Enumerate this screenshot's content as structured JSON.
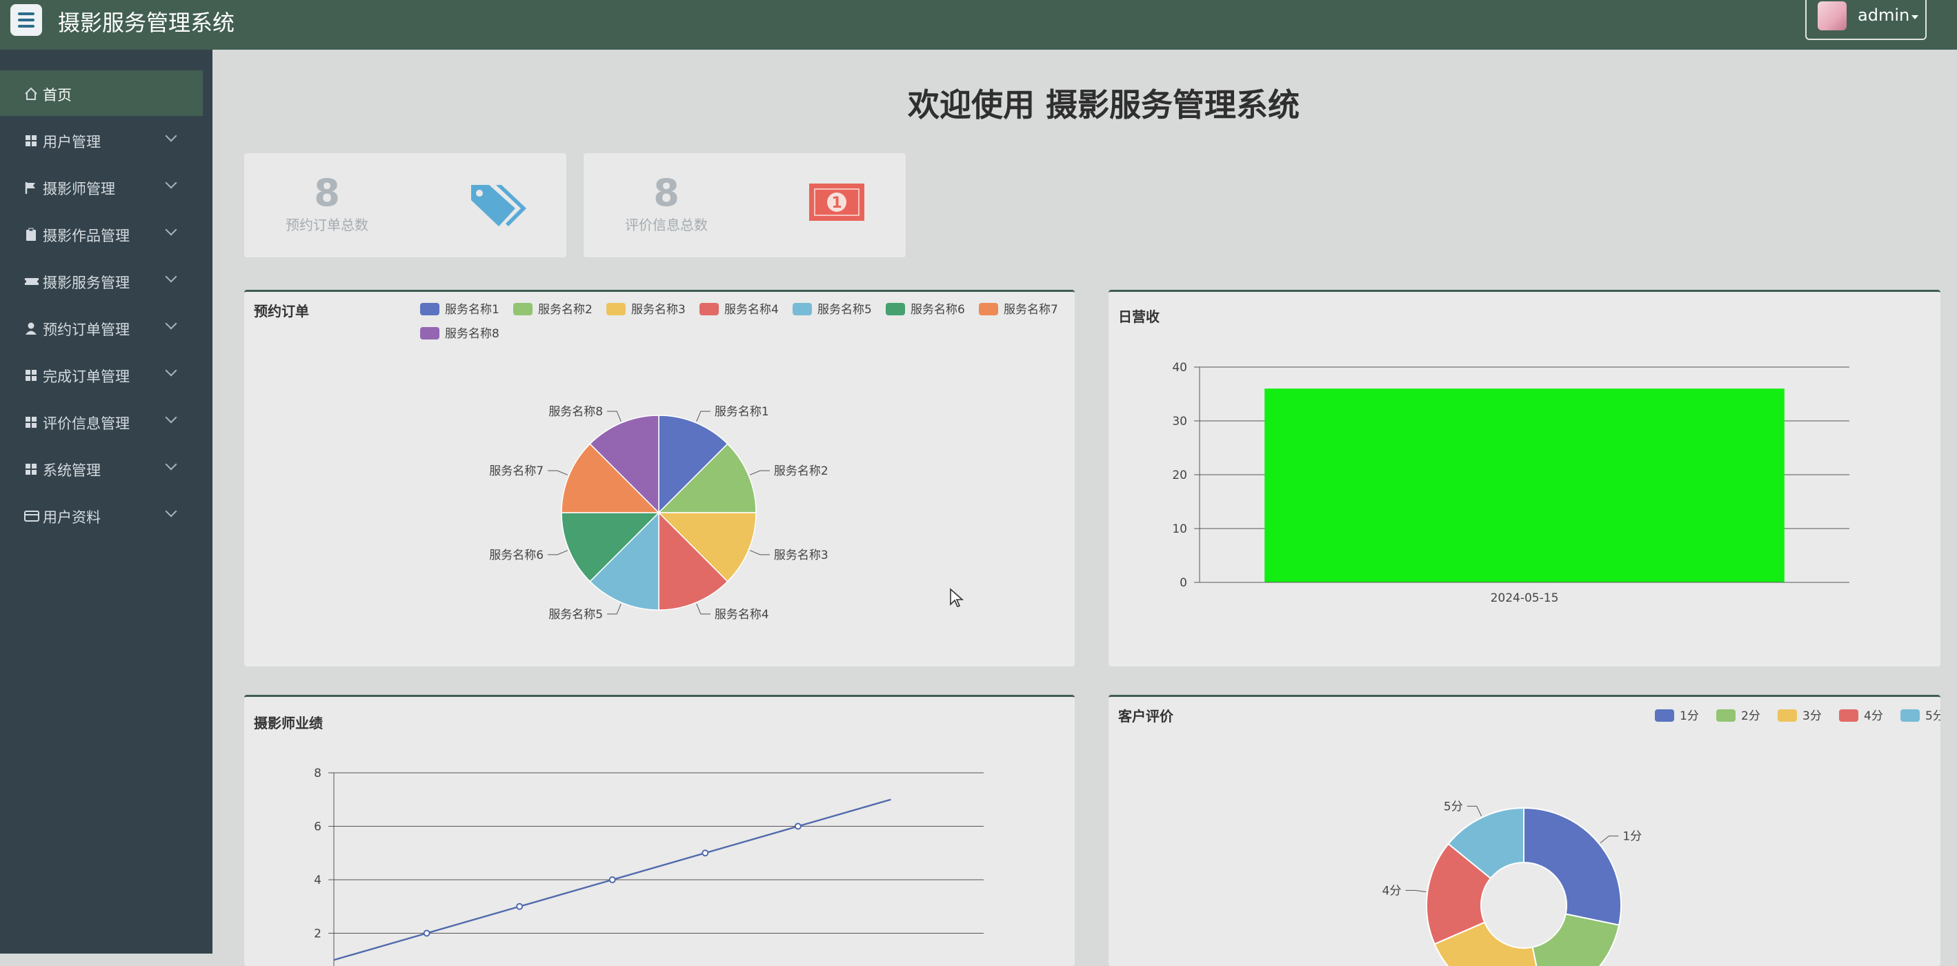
{
  "header": {
    "title": "摄影服务管理系统",
    "user": "admin"
  },
  "sidebar": {
    "items": [
      {
        "label": "首页",
        "icon": "home-icon",
        "active": true
      },
      {
        "label": "用户管理",
        "icon": "grid-icon"
      },
      {
        "label": "摄影师管理",
        "icon": "flag-icon"
      },
      {
        "label": "摄影作品管理",
        "icon": "clipboard-icon"
      },
      {
        "label": "摄影服务管理",
        "icon": "ticket-icon"
      },
      {
        "label": "预约订单管理",
        "icon": "user-icon"
      },
      {
        "label": "完成订单管理",
        "icon": "grid-icon"
      },
      {
        "label": "评价信息管理",
        "icon": "grid-icon"
      },
      {
        "label": "系统管理",
        "icon": "grid-icon"
      },
      {
        "label": "用户资料",
        "icon": "card-icon"
      }
    ]
  },
  "main": {
    "welcome": "欢迎使用 摄影服务管理系统"
  },
  "stats": [
    {
      "value": "8",
      "label": "预约订单总数",
      "icon": "tags-icon",
      "color": "#5aaad6"
    },
    {
      "value": "8",
      "label": "评价信息总数",
      "icon": "money-icon",
      "color": "#e8645a"
    }
  ],
  "panels": {
    "orders": "预约订单",
    "revenue": "日营收",
    "performance": "摄影师业绩",
    "reviews": "客户评价"
  },
  "chart_data": [
    {
      "type": "pie",
      "title": "预约订单",
      "categories": [
        "服务名称1",
        "服务名称2",
        "服务名称3",
        "服务名称4",
        "服务名称5",
        "服务名称6",
        "服务名称7",
        "服务名称8"
      ],
      "values": [
        1,
        1,
        1,
        1,
        1,
        1,
        1,
        1
      ],
      "colors": [
        "#5b73c0",
        "#92c472",
        "#efc35c",
        "#e16a67",
        "#78bbd6",
        "#46a070",
        "#ee8a55",
        "#9466b2"
      ],
      "legend": "top"
    },
    {
      "type": "bar",
      "title": "日营收",
      "categories": [
        "2024-05-15"
      ],
      "values": [
        36
      ],
      "ylim": [
        0,
        40
      ],
      "yticks": [
        0,
        10,
        20,
        30,
        40
      ],
      "color": "#12ee12",
      "grid": true
    },
    {
      "type": "line",
      "title": "摄影师业绩",
      "x": [
        0,
        1,
        2,
        3,
        4,
        5,
        6
      ],
      "values": [
        1,
        2,
        3,
        4,
        5,
        6,
        7
      ],
      "ylim": [
        0,
        8
      ],
      "yticks": [
        2,
        4,
        6,
        8
      ],
      "color": "#5169ad",
      "grid": true
    },
    {
      "type": "pie",
      "title": "客户评价",
      "categories": [
        "1分",
        "2分",
        "3分",
        "4分",
        "5分"
      ],
      "values": [
        26,
        17,
        20,
        16,
        13
      ],
      "colors": [
        "#5b73c0",
        "#92c472",
        "#efc35c",
        "#e16a67",
        "#78bbd6"
      ],
      "legend": "top-right"
    }
  ]
}
